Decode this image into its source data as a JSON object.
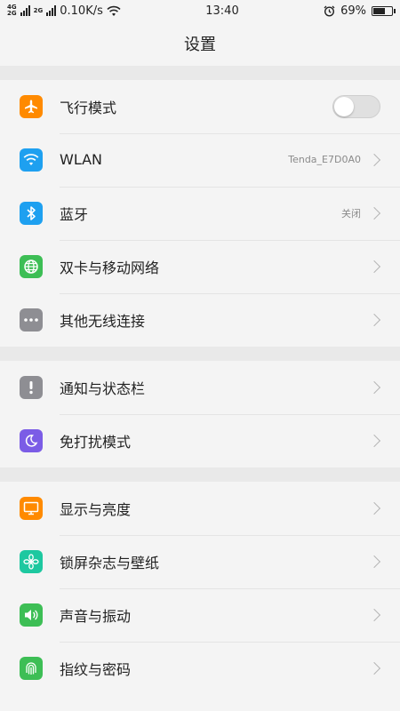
{
  "status_bar": {
    "net_top": "4G",
    "net_bottom": "2G",
    "net_small": "2G",
    "speed": "0.10K/s",
    "time": "13:40",
    "battery_percent": "69%",
    "battery_level": 0.69,
    "icons": [
      "signal-icon",
      "wifi-icon",
      "alarm-icon",
      "battery-icon"
    ]
  },
  "header": {
    "title": "设置"
  },
  "groups": [
    {
      "items": [
        {
          "label": "飞行模式",
          "icon": "airplane-icon",
          "icon_color": "#ff8a00",
          "toggle": false
        },
        {
          "label": "WLAN",
          "icon": "wifi-icon",
          "icon_color": "#1ea0f0",
          "value": "Tenda_E7D0A0"
        },
        {
          "label": "蓝牙",
          "icon": "bluetooth-icon",
          "icon_color": "#1ea0f0",
          "value": "关闭"
        },
        {
          "label": "双卡与移动网络",
          "icon": "globe-icon",
          "icon_color": "#3dbe55"
        },
        {
          "label": "其他无线连接",
          "icon": "more-icon",
          "icon_color": "#8e8e93"
        }
      ]
    },
    {
      "items": [
        {
          "label": "通知与状态栏",
          "icon": "notification-icon",
          "icon_color": "#8e8e93"
        },
        {
          "label": "免打扰模式",
          "icon": "moon-icon",
          "icon_color": "#7b5ce6"
        }
      ]
    },
    {
      "items": [
        {
          "label": "显示与亮度",
          "icon": "display-icon",
          "icon_color": "#ff8a00"
        },
        {
          "label": "锁屏杂志与壁纸",
          "icon": "flower-icon",
          "icon_color": "#1ec8a0"
        },
        {
          "label": "声音与振动",
          "icon": "speaker-icon",
          "icon_color": "#3dbe55"
        },
        {
          "label": "指纹与密码",
          "icon": "fingerprint-icon",
          "icon_color": "#3dbe55"
        }
      ]
    }
  ]
}
